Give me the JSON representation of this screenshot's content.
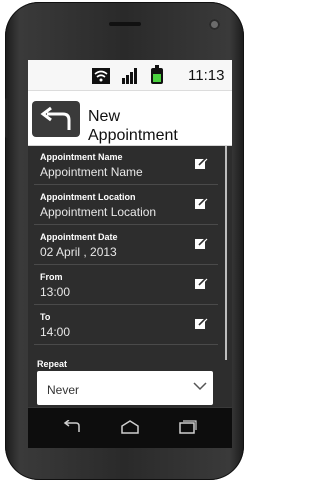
{
  "status": {
    "time": "11:13"
  },
  "header": {
    "title_line1": "New",
    "title_line2": "Appointment"
  },
  "form": {
    "fields": [
      {
        "label": "Appointment Name",
        "value": "Appointment Name"
      },
      {
        "label": "Appointment Location",
        "value": "Appointment Location"
      },
      {
        "label": "Appointment Date",
        "value": "02 April , 2013"
      },
      {
        "label": "From",
        "value": "13:00"
      },
      {
        "label": "To",
        "value": "14:00"
      }
    ],
    "repeat_label": "Repeat",
    "repeat_value": "Never"
  },
  "icons": [
    "wifi-icon",
    "signal-icon",
    "battery-icon",
    "back-arrow-icon",
    "edit-icon",
    "chevron-down-icon",
    "nav-back-icon",
    "nav-home-icon",
    "nav-recents-icon"
  ],
  "colors": {
    "battery": "#4bd23f",
    "form_bg": "#2d2d2d",
    "header_bg": "#ffffff"
  }
}
